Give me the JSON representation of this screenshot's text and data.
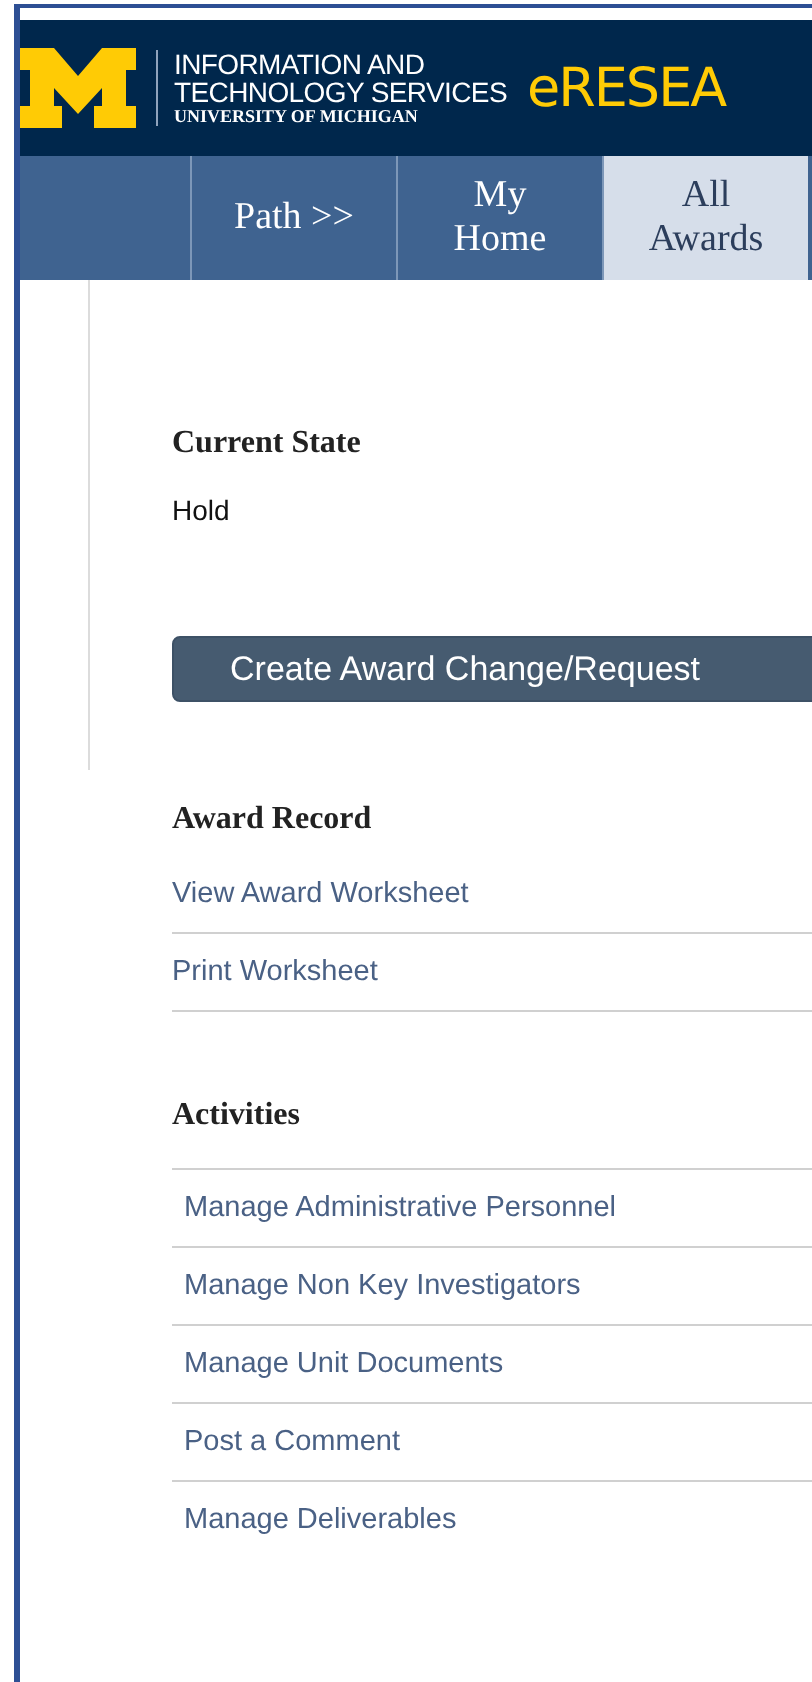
{
  "header": {
    "org_line1": "INFORMATION AND",
    "org_line2": "TECHNOLOGY SERVICES",
    "org_line3": "UNIVERSITY OF MICHIGAN",
    "product": "eRESEA"
  },
  "tabs": [
    {
      "label": "Path >>",
      "selected": false
    },
    {
      "label": "My\nHome",
      "selected": false
    },
    {
      "label": "All\nAwards",
      "selected": true
    }
  ],
  "current_state": {
    "heading": "Current State",
    "value": "Hold"
  },
  "action_button": "Create Award Change/Request",
  "award_record": {
    "heading": "Award Record",
    "links": [
      "View Award Worksheet",
      "Print Worksheet"
    ]
  },
  "activities": {
    "heading": "Activities",
    "links": [
      "Manage Administrative Personnel",
      "Manage Non Key Investigators",
      "Manage Unit Documents",
      "Post a Comment",
      "Manage Deliverables"
    ]
  }
}
